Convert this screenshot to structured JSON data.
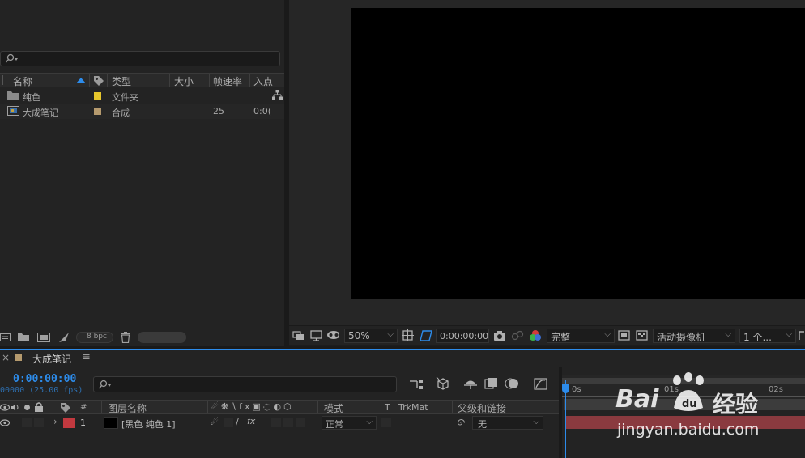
{
  "project": {
    "columns": [
      "名称",
      "类型",
      "大小",
      "帧速率",
      "入点"
    ],
    "items": [
      {
        "name": "纯色",
        "type": "文件夹",
        "fps": "",
        "in": "",
        "color": "#e6c62c"
      },
      {
        "name": "大成笔记",
        "type": "合成",
        "fps": "25",
        "in": "0:0(",
        "color": "#b59a6e"
      }
    ],
    "bpc": "8 bpc"
  },
  "viewer": {
    "zoom": "50%",
    "timecode": "0:00:00:00",
    "resolution": "完整",
    "camera": "活动摄像机",
    "views": "1 个..."
  },
  "timeline": {
    "comp_name": "大成笔记",
    "menu_glyph": "≡",
    "close_glyph": "×",
    "current_time": "0:00:00:00",
    "fps_line": "00000 (25.00 fps)",
    "header": {
      "number": "#",
      "layer_name": "图层名称",
      "mode": "模式",
      "t": "T",
      "trkmat": "TrkMat",
      "parent": "父级和链接"
    },
    "layers": [
      {
        "index": "1",
        "name": "[黑色 纯色 1]",
        "mode": "正常",
        "parent": "无",
        "label_color": "#c2393f"
      }
    ],
    "ruler": {
      "t0": "0s",
      "t1": "01s",
      "t2": "02s"
    }
  },
  "watermark": {
    "brand_left": "Bai",
    "brand_right": "经验",
    "url": "jingyan.baidu.com"
  },
  "colors": {
    "accent": "#2d8ceb",
    "layer_bar": "#8a3a3f"
  }
}
